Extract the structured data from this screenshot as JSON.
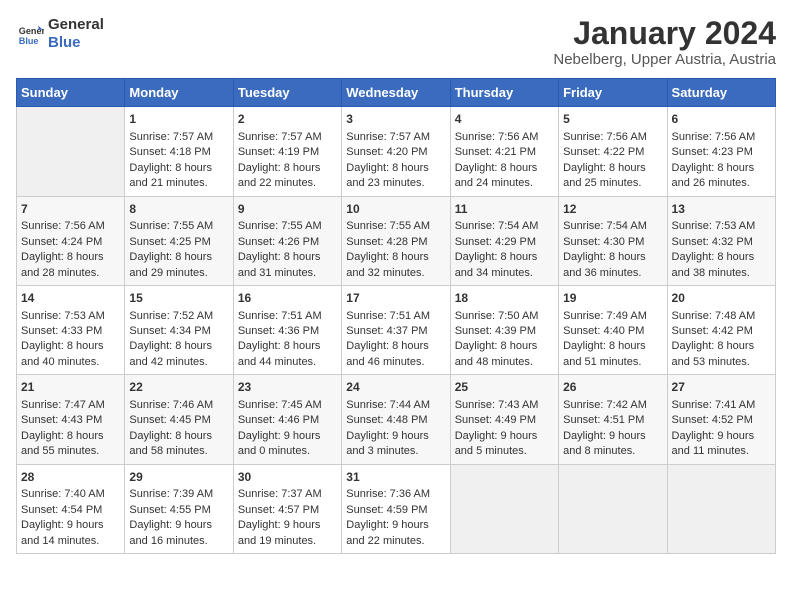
{
  "header": {
    "logo_line1": "General",
    "logo_line2": "Blue",
    "title": "January 2024",
    "subtitle": "Nebelberg, Upper Austria, Austria"
  },
  "days_header": [
    "Sunday",
    "Monday",
    "Tuesday",
    "Wednesday",
    "Thursday",
    "Friday",
    "Saturday"
  ],
  "weeks": [
    [
      {
        "num": "",
        "sunrise": "",
        "sunset": "",
        "daylight": ""
      },
      {
        "num": "1",
        "sunrise": "Sunrise: 7:57 AM",
        "sunset": "Sunset: 4:18 PM",
        "daylight": "Daylight: 8 hours and 21 minutes."
      },
      {
        "num": "2",
        "sunrise": "Sunrise: 7:57 AM",
        "sunset": "Sunset: 4:19 PM",
        "daylight": "Daylight: 8 hours and 22 minutes."
      },
      {
        "num": "3",
        "sunrise": "Sunrise: 7:57 AM",
        "sunset": "Sunset: 4:20 PM",
        "daylight": "Daylight: 8 hours and 23 minutes."
      },
      {
        "num": "4",
        "sunrise": "Sunrise: 7:56 AM",
        "sunset": "Sunset: 4:21 PM",
        "daylight": "Daylight: 8 hours and 24 minutes."
      },
      {
        "num": "5",
        "sunrise": "Sunrise: 7:56 AM",
        "sunset": "Sunset: 4:22 PM",
        "daylight": "Daylight: 8 hours and 25 minutes."
      },
      {
        "num": "6",
        "sunrise": "Sunrise: 7:56 AM",
        "sunset": "Sunset: 4:23 PM",
        "daylight": "Daylight: 8 hours and 26 minutes."
      }
    ],
    [
      {
        "num": "7",
        "sunrise": "Sunrise: 7:56 AM",
        "sunset": "Sunset: 4:24 PM",
        "daylight": "Daylight: 8 hours and 28 minutes."
      },
      {
        "num": "8",
        "sunrise": "Sunrise: 7:55 AM",
        "sunset": "Sunset: 4:25 PM",
        "daylight": "Daylight: 8 hours and 29 minutes."
      },
      {
        "num": "9",
        "sunrise": "Sunrise: 7:55 AM",
        "sunset": "Sunset: 4:26 PM",
        "daylight": "Daylight: 8 hours and 31 minutes."
      },
      {
        "num": "10",
        "sunrise": "Sunrise: 7:55 AM",
        "sunset": "Sunset: 4:28 PM",
        "daylight": "Daylight: 8 hours and 32 minutes."
      },
      {
        "num": "11",
        "sunrise": "Sunrise: 7:54 AM",
        "sunset": "Sunset: 4:29 PM",
        "daylight": "Daylight: 8 hours and 34 minutes."
      },
      {
        "num": "12",
        "sunrise": "Sunrise: 7:54 AM",
        "sunset": "Sunset: 4:30 PM",
        "daylight": "Daylight: 8 hours and 36 minutes."
      },
      {
        "num": "13",
        "sunrise": "Sunrise: 7:53 AM",
        "sunset": "Sunset: 4:32 PM",
        "daylight": "Daylight: 8 hours and 38 minutes."
      }
    ],
    [
      {
        "num": "14",
        "sunrise": "Sunrise: 7:53 AM",
        "sunset": "Sunset: 4:33 PM",
        "daylight": "Daylight: 8 hours and 40 minutes."
      },
      {
        "num": "15",
        "sunrise": "Sunrise: 7:52 AM",
        "sunset": "Sunset: 4:34 PM",
        "daylight": "Daylight: 8 hours and 42 minutes."
      },
      {
        "num": "16",
        "sunrise": "Sunrise: 7:51 AM",
        "sunset": "Sunset: 4:36 PM",
        "daylight": "Daylight: 8 hours and 44 minutes."
      },
      {
        "num": "17",
        "sunrise": "Sunrise: 7:51 AM",
        "sunset": "Sunset: 4:37 PM",
        "daylight": "Daylight: 8 hours and 46 minutes."
      },
      {
        "num": "18",
        "sunrise": "Sunrise: 7:50 AM",
        "sunset": "Sunset: 4:39 PM",
        "daylight": "Daylight: 8 hours and 48 minutes."
      },
      {
        "num": "19",
        "sunrise": "Sunrise: 7:49 AM",
        "sunset": "Sunset: 4:40 PM",
        "daylight": "Daylight: 8 hours and 51 minutes."
      },
      {
        "num": "20",
        "sunrise": "Sunrise: 7:48 AM",
        "sunset": "Sunset: 4:42 PM",
        "daylight": "Daylight: 8 hours and 53 minutes."
      }
    ],
    [
      {
        "num": "21",
        "sunrise": "Sunrise: 7:47 AM",
        "sunset": "Sunset: 4:43 PM",
        "daylight": "Daylight: 8 hours and 55 minutes."
      },
      {
        "num": "22",
        "sunrise": "Sunrise: 7:46 AM",
        "sunset": "Sunset: 4:45 PM",
        "daylight": "Daylight: 8 hours and 58 minutes."
      },
      {
        "num": "23",
        "sunrise": "Sunrise: 7:45 AM",
        "sunset": "Sunset: 4:46 PM",
        "daylight": "Daylight: 9 hours and 0 minutes."
      },
      {
        "num": "24",
        "sunrise": "Sunrise: 7:44 AM",
        "sunset": "Sunset: 4:48 PM",
        "daylight": "Daylight: 9 hours and 3 minutes."
      },
      {
        "num": "25",
        "sunrise": "Sunrise: 7:43 AM",
        "sunset": "Sunset: 4:49 PM",
        "daylight": "Daylight: 9 hours and 5 minutes."
      },
      {
        "num": "26",
        "sunrise": "Sunrise: 7:42 AM",
        "sunset": "Sunset: 4:51 PM",
        "daylight": "Daylight: 9 hours and 8 minutes."
      },
      {
        "num": "27",
        "sunrise": "Sunrise: 7:41 AM",
        "sunset": "Sunset: 4:52 PM",
        "daylight": "Daylight: 9 hours and 11 minutes."
      }
    ],
    [
      {
        "num": "28",
        "sunrise": "Sunrise: 7:40 AM",
        "sunset": "Sunset: 4:54 PM",
        "daylight": "Daylight: 9 hours and 14 minutes."
      },
      {
        "num": "29",
        "sunrise": "Sunrise: 7:39 AM",
        "sunset": "Sunset: 4:55 PM",
        "daylight": "Daylight: 9 hours and 16 minutes."
      },
      {
        "num": "30",
        "sunrise": "Sunrise: 7:37 AM",
        "sunset": "Sunset: 4:57 PM",
        "daylight": "Daylight: 9 hours and 19 minutes."
      },
      {
        "num": "31",
        "sunrise": "Sunrise: 7:36 AM",
        "sunset": "Sunset: 4:59 PM",
        "daylight": "Daylight: 9 hours and 22 minutes."
      },
      {
        "num": "",
        "sunrise": "",
        "sunset": "",
        "daylight": ""
      },
      {
        "num": "",
        "sunrise": "",
        "sunset": "",
        "daylight": ""
      },
      {
        "num": "",
        "sunrise": "",
        "sunset": "",
        "daylight": ""
      }
    ]
  ]
}
